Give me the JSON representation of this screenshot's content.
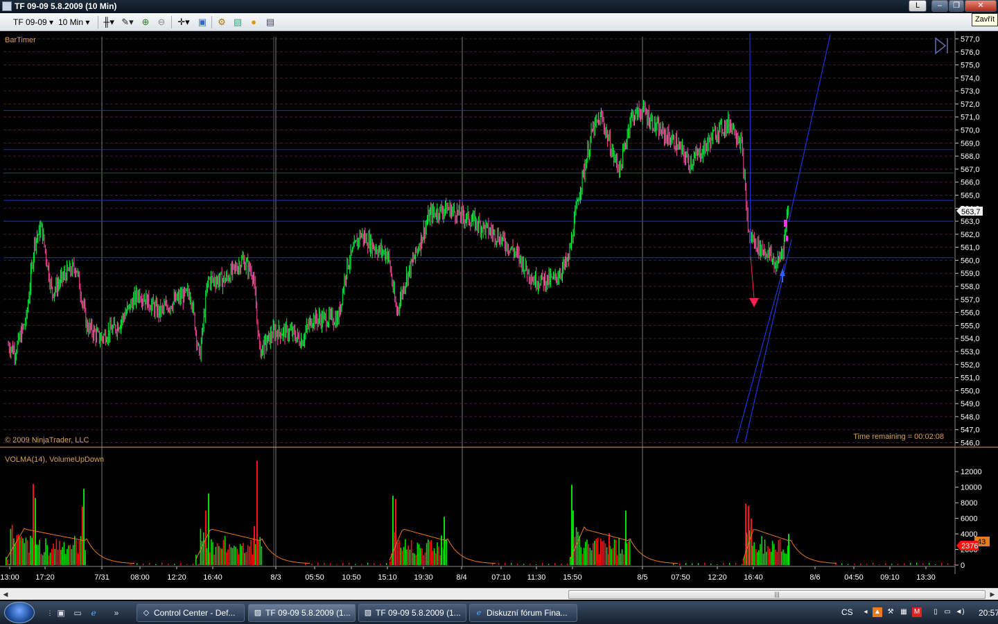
{
  "window": {
    "title": "TF 09-09  5.8.2009 (10 Min)",
    "tooltip": "Zavřít",
    "lang_button": "L"
  },
  "toolbar": {
    "instrument": "TF 09-09",
    "interval": "10 Min",
    "icons": [
      "bar-style-icon",
      "drawing-pencil-icon",
      "zoom-in-icon",
      "zoom-out-icon",
      "crosshair-icon",
      "properties-icon",
      "strategy-icon",
      "indicator-icon",
      "currency-icon",
      "data-box-icon"
    ]
  },
  "chart_data": {
    "type": "line",
    "instrument": "TF 09-09",
    "price_panel": {
      "indicator_label": "BarTimer",
      "copyright": "© 2009 NinjaTrader, LLC",
      "time_remaining": "Time remaining = 00:02:08",
      "current_price": "563,7",
      "ylim": [
        546,
        577
      ],
      "y_ticks": [
        "577,0",
        "576,0",
        "575,0",
        "574,0",
        "573,0",
        "572,0",
        "571,0",
        "570,0",
        "569,0",
        "568,0",
        "567,0",
        "566,0",
        "565,0",
        "564,0",
        "563,0",
        "562,0",
        "561,0",
        "560,0",
        "559,0",
        "558,0",
        "557,0",
        "556,0",
        "555,0",
        "554,0",
        "553,0",
        "552,0",
        "551,0",
        "550,0",
        "549,0",
        "548,0",
        "547,0",
        "546,0"
      ],
      "horizontal_lines": [
        571.5,
        568.5,
        566.7,
        564.6,
        563.0,
        560.2
      ],
      "series": [
        {
          "name": "TF 09-09",
          "x": [
            "13:00",
            "17:20",
            "7/31",
            "08:00",
            "12:20",
            "16:40",
            "8/3",
            "05:50",
            "10:50",
            "15:10",
            "19:30",
            "8/4",
            "07:10",
            "11:30",
            "15:50",
            "8/5",
            "07:50",
            "12:20",
            "16:40"
          ],
          "values": [
            553.0,
            561.0,
            554.0,
            556.5,
            557.5,
            558.5,
            554.0,
            555.5,
            560.5,
            560.5,
            563.5,
            563.5,
            560.0,
            559.0,
            570.0,
            570.5,
            568.5,
            570.5,
            561.0
          ]
        }
      ]
    },
    "volume_panel": {
      "indicator_label": "VOLMA(14), VolumeUpDown",
      "ylim": [
        0,
        13000
      ],
      "y_ticks": [
        "12000",
        "10000",
        "8000",
        "6000",
        "4000",
        "2000",
        "0"
      ],
      "current_volume": "2376",
      "current_volma": "43",
      "sessions": [
        {
          "peak_up": 9800,
          "peak_down": 10400
        },
        {
          "peak_up": 9200,
          "peak_down": 13400
        },
        {
          "peak_up": 8900,
          "peak_down": 8500
        },
        {
          "peak_up": 10300,
          "peak_down": 4100
        },
        {
          "peak_up": 4000,
          "peak_down": 7900
        }
      ]
    },
    "x_ticks": [
      "13:00",
      "17:20",
      "7/31",
      "08:00",
      "12:20",
      "16:40",
      "8/3",
      "05:50",
      "10:50",
      "15:10",
      "19:30",
      "8/4",
      "07:10",
      "11:30",
      "15:50",
      "8/5",
      "07:50",
      "12:20",
      "16:40",
      "8/6",
      "04:50",
      "09:10",
      "13:30"
    ],
    "colors": {
      "up": "#00e000",
      "down": "#ff1010",
      "price_up": "#00ff40",
      "price_down": "#ff4aa0",
      "hline": "#1f2fcf",
      "axis_text": "#ffffff",
      "label": "#d9a05b",
      "volma": "#e87a20"
    }
  },
  "scrollbar": {
    "grip": "|||"
  },
  "taskbar": {
    "tasks": [
      {
        "label": "Control Center - Def...",
        "icon": "control-center-icon"
      },
      {
        "label": "TF 09-09  5.8.2009 (1...",
        "icon": "chart-icon",
        "active": true
      },
      {
        "label": "TF 09-09  5.8.2009 (1...",
        "icon": "chart-icon"
      },
      {
        "label": "Diskuzní fórum Fina...",
        "icon": "ie-icon"
      }
    ],
    "lang": "CS",
    "clock": "20:57"
  }
}
